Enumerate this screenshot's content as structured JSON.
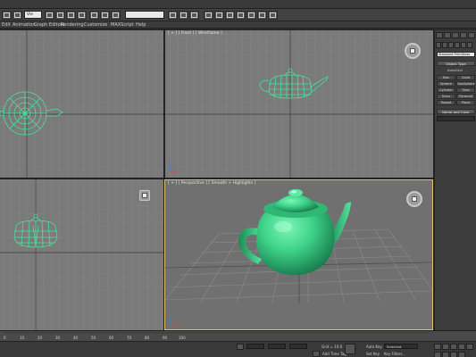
{
  "window": {
    "title": ""
  },
  "toolbar": {
    "selection_filter": "Vie",
    "viewport_selector": ""
  },
  "menu": {
    "items": [
      "Edit",
      "Animation",
      "Graph Editors",
      "Rendering",
      "Customize",
      "MAXScript",
      "Help"
    ]
  },
  "viewports": {
    "left_top_label": "",
    "front_label": "[ + ] [ Front ] [ Wireframe ]",
    "perspective_label": "[ + ] [ Perspective ] [ Smooth + Highlights ]"
  },
  "command_panel": {
    "category": "Standard Primitives",
    "object_type_header": "Object Type",
    "autogrid_label": "AutoGrid",
    "buttons": [
      "Box",
      "Cone",
      "Sphere",
      "GeoSphere",
      "Cylinder",
      "Tube",
      "Torus",
      "Pyramid",
      "Teapot",
      "Plane"
    ],
    "name_color_header": "Name and Color"
  },
  "timeline": {
    "ticks": [
      "0",
      "10",
      "20",
      "30",
      "40",
      "50",
      "60",
      "70",
      "80",
      "90",
      "100"
    ]
  },
  "status": {
    "x_field": "",
    "y_field": "",
    "z_field": "",
    "grid": "Grid = 10.0",
    "auto_key": "Auto Key",
    "selected": "Selected",
    "set_key": "Set Key",
    "key_filters": "Key Filters...",
    "add_time_tag": "Add Time Tag"
  },
  "colors": {
    "object_green": "#3fd48a",
    "wire_green": "#47e39a",
    "viewport_bg": "#7a7a7a",
    "perspective_bg": "#6f6f6f",
    "active_border": "#e0c060"
  }
}
